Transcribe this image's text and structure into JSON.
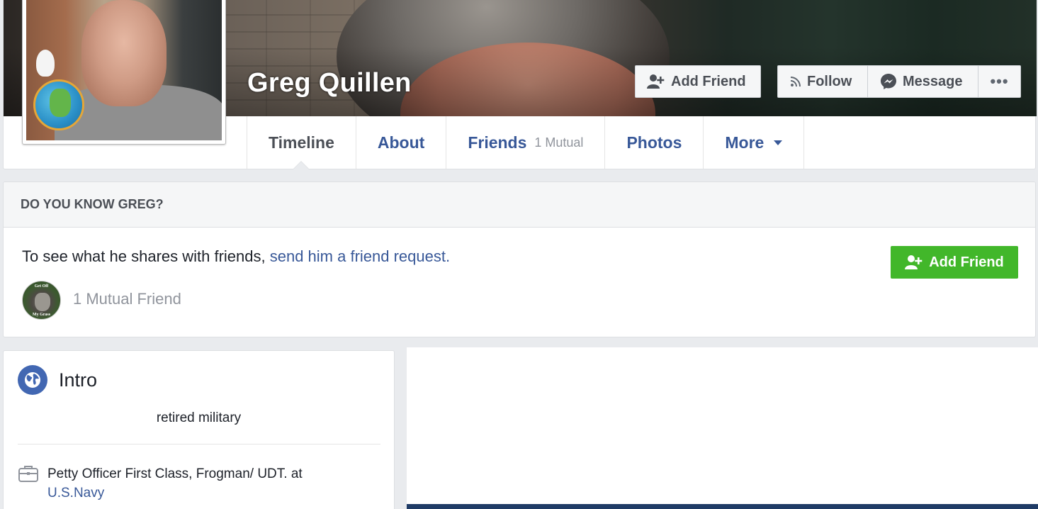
{
  "profile": {
    "name": "Greg Quillen"
  },
  "actions": {
    "add_friend": "Add Friend",
    "follow": "Follow",
    "message": "Message",
    "more": "•••"
  },
  "tabs": [
    {
      "label": "Timeline",
      "active": true
    },
    {
      "label": "About"
    },
    {
      "label": "Friends",
      "sub": "1 Mutual"
    },
    {
      "label": "Photos"
    },
    {
      "label": "More"
    }
  ],
  "know_card": {
    "header": "DO YOU KNOW GREG?",
    "prompt": "To see what he shares with friends, ",
    "link": "send him a friend request.",
    "button": "Add Friend",
    "mutual": "1 Mutual Friend",
    "mutual_avatar_top": "Get Off",
    "mutual_avatar_bottom": "My Grass"
  },
  "intro": {
    "title": "Intro",
    "bio": "retired military",
    "work_text": "Petty Officer First Class, Frogman/ UDT. at",
    "work_link": "U.S.Navy"
  },
  "colors": {
    "link": "#385898",
    "green": "#42b72a",
    "intro_icon": "#4267b2"
  }
}
